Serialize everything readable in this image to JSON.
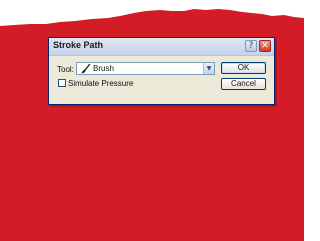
{
  "background": {
    "top_color": "#ffffff",
    "fill_color": "#d31c26"
  },
  "dialog": {
    "title": "Stroke Path",
    "help_icon": "help-icon",
    "close_icon": "close-icon",
    "tool_label": "Tool:",
    "tool_value": "Brush",
    "tool_icon": "brush-icon",
    "dropdown_icon": "chevron-down-icon",
    "simulate_pressure_label": "Simulate Pressure",
    "simulate_pressure_checked": false,
    "ok_label": "OK",
    "cancel_label": "Cancel"
  }
}
